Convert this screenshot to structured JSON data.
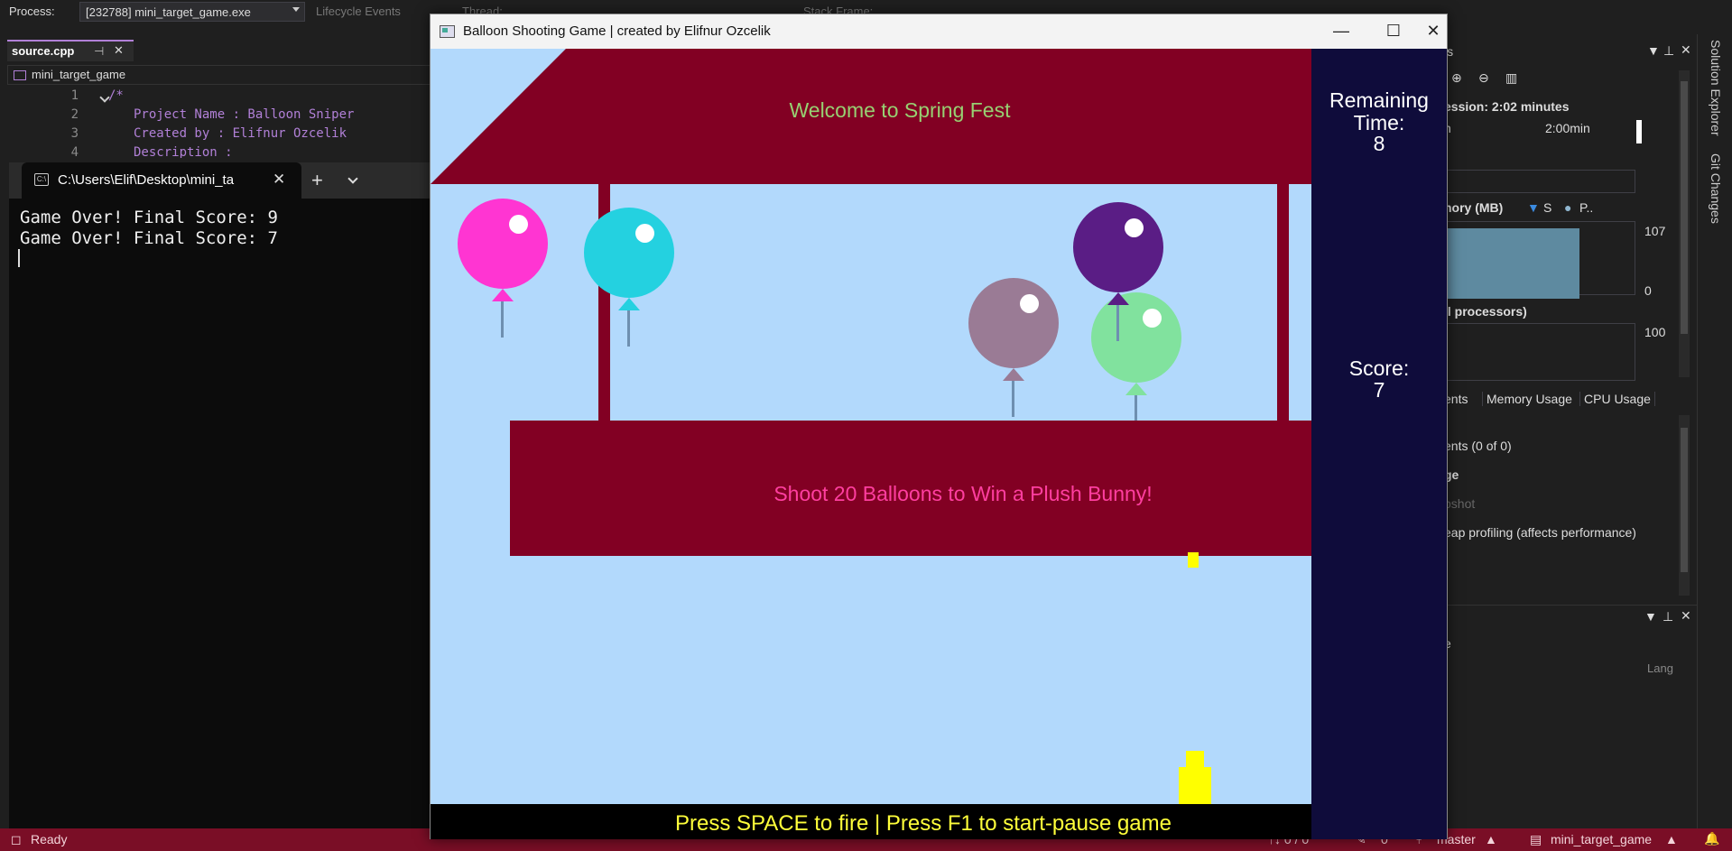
{
  "vs": {
    "process_label": "Process:",
    "process_value": "[232788] mini_target_game.exe",
    "lifecycle": "Lifecycle Events",
    "thread": "Thread:",
    "stack_frame": "Stack Frame:",
    "tab": "source.cpp",
    "nav_scope": "mini_target_game",
    "code_lines": [
      {
        "num": "1",
        "text": "/*"
      },
      {
        "num": "2",
        "text": "Project Name : Balloon Sniper"
      },
      {
        "num": "3",
        "text": "Created by : Elifnur Ozcelik"
      },
      {
        "num": "4",
        "text": "Description :"
      }
    ],
    "diag": {
      "title_partial": "ls",
      "session": "ession: 2:02 minutes",
      "tick_a": "n",
      "tick_b": "2:00min",
      "memory_label": "nory (MB)",
      "legend_s": "S",
      "legend_p": "P..",
      "mem_max": "107",
      "mem_min": "0",
      "cpu_label": "ll processors)",
      "cpu_max": "100",
      "tabs": [
        "ents",
        "Memory Usage",
        "CPU Usage"
      ],
      "events": "ents (0 of 0)",
      "ge": "ge",
      "snapshot": "pshot",
      "heap": "eap profiling (affects performance)",
      "lower_e": "e",
      "lang": "Lang"
    },
    "side_tabs": [
      "Solution Explorer",
      "Git Changes"
    ],
    "status": {
      "ready": "Ready",
      "arrows": "↑↓ 0 / 0",
      "pencil": "0",
      "branch": "master",
      "repo": "mini_target_game"
    }
  },
  "terminal": {
    "tab_title": "C:\\Users\\Elif\\Desktop\\mini_ta",
    "lines": [
      "Game Over! Final Score: 9",
      "Game Over! Final Score: 7"
    ]
  },
  "game": {
    "window_title": "Balloon Shooting Game | created by Elifnur Ozcelik",
    "welcome": "Welcome to Spring Fest",
    "banner": "Shoot 20 Balloons to Win a Plush Bunny!",
    "instructions": "Press SPACE to fire | Press F1 to start-pause game",
    "remaining_label_1": "Remaining",
    "remaining_label_2": "Time:",
    "remaining_value": "8",
    "score_label": "Score:",
    "score_value": "7",
    "colors": {
      "awning": "#820023",
      "sky": "#b2d9fc",
      "panel": "#0f0c3b",
      "balloons": [
        "#ff35d2",
        "#24d1e0",
        "#9a7b95",
        "#5a1d85",
        "#81e29e"
      ],
      "shooter": "#ffff00"
    }
  }
}
